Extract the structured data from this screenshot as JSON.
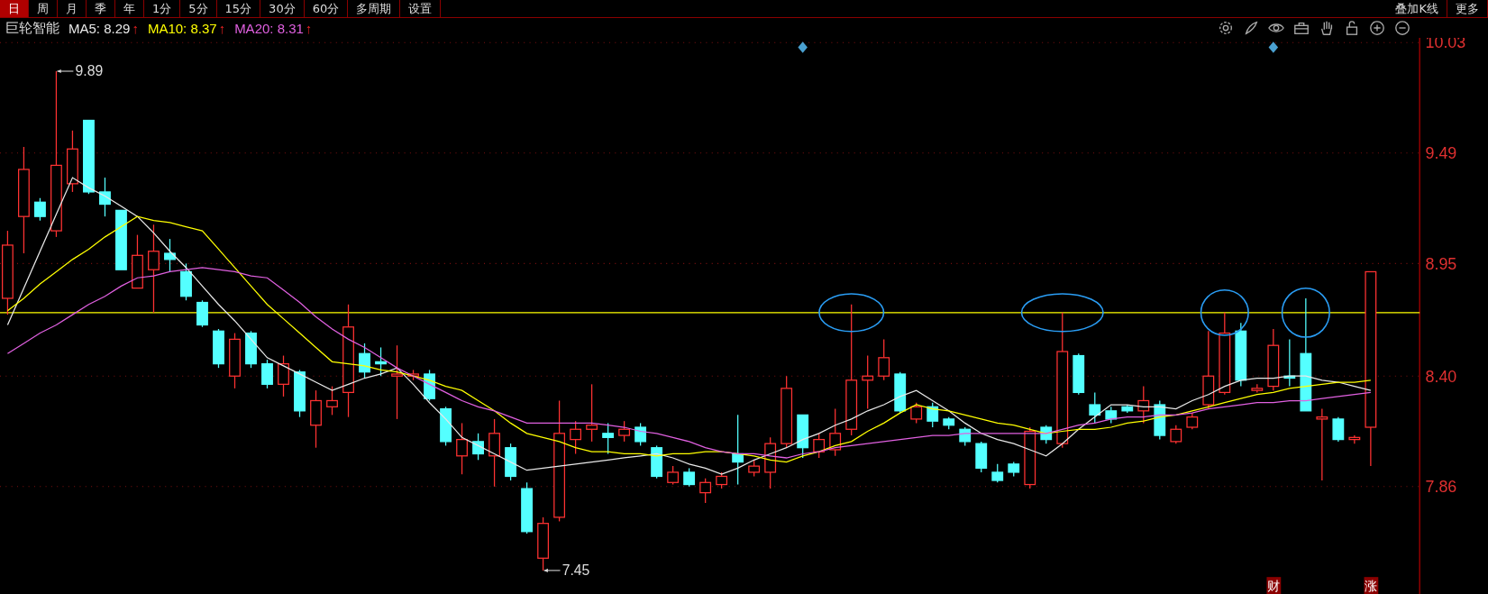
{
  "toolbar": {
    "left": [
      {
        "label": "日",
        "selected": true
      },
      {
        "label": "周",
        "selected": false
      },
      {
        "label": "月",
        "selected": false
      },
      {
        "label": "季",
        "selected": false
      },
      {
        "label": "年",
        "selected": false
      },
      {
        "label": "1分",
        "selected": false
      },
      {
        "label": "5分",
        "selected": false
      },
      {
        "label": "15分",
        "selected": false
      },
      {
        "label": "30分",
        "selected": false
      },
      {
        "label": "60分",
        "selected": false
      },
      {
        "label": "多周期",
        "selected": false
      },
      {
        "label": "设置",
        "selected": false
      }
    ],
    "right": [
      {
        "label": "叠加K线",
        "selected": false
      },
      {
        "label": "更多",
        "selected": false
      }
    ]
  },
  "header": {
    "name": "巨轮智能",
    "ma": [
      {
        "separator": ":",
        "value": "8.29",
        "trend": "↑"
      },
      {
        "separator": ":",
        "value": "8.37",
        "trend": "↑"
      },
      {
        "separator": ":",
        "value": "8.31",
        "trend": "↑"
      }
    ]
  },
  "chart_data": {
    "type": "candlestick",
    "ylim": [
      7.335,
      10.053
    ],
    "grid": true,
    "yticks": [
      {
        "value": 10.03,
        "label": "10.03"
      },
      {
        "value": 9.49,
        "label": "9.49"
      },
      {
        "value": 8.95,
        "label": "8.95"
      },
      {
        "value": 8.4,
        "label": "8.40"
      },
      {
        "value": 7.86,
        "label": "7.86"
      }
    ],
    "ohlc": [
      [
        8.78,
        9.11,
        8.7,
        9.04
      ],
      [
        9.18,
        9.52,
        9.0,
        9.41
      ],
      [
        9.25,
        9.27,
        9.16,
        9.18
      ],
      [
        9.11,
        9.89,
        9.08,
        9.43
      ],
      [
        9.34,
        9.6,
        9.3,
        9.51
      ],
      [
        9.65,
        9.65,
        9.29,
        9.3
      ],
      [
        9.3,
        9.37,
        9.18,
        9.24
      ],
      [
        9.21,
        9.21,
        8.92,
        8.92
      ],
      [
        8.83,
        9.09,
        8.83,
        8.99
      ],
      [
        8.92,
        9.14,
        8.71,
        9.01
      ],
      [
        9.0,
        9.07,
        8.91,
        8.97
      ],
      [
        8.91,
        8.95,
        8.77,
        8.79
      ],
      [
        8.76,
        8.77,
        8.64,
        8.65
      ],
      [
        8.62,
        8.63,
        8.44,
        8.46
      ],
      [
        8.4,
        8.61,
        8.34,
        8.58
      ],
      [
        8.61,
        8.62,
        8.44,
        8.46
      ],
      [
        8.46,
        8.48,
        8.34,
        8.36
      ],
      [
        8.36,
        8.5,
        8.3,
        8.46
      ],
      [
        8.42,
        8.43,
        8.2,
        8.23
      ],
      [
        8.16,
        8.33,
        8.05,
        8.28
      ],
      [
        8.25,
        8.35,
        8.21,
        8.28
      ],
      [
        8.32,
        8.75,
        8.2,
        8.64
      ],
      [
        8.51,
        8.56,
        8.39,
        8.42
      ],
      [
        8.47,
        8.54,
        8.4,
        8.46
      ],
      [
        8.4,
        8.55,
        8.19,
        8.41
      ],
      [
        8.4,
        8.43,
        8.38,
        8.41
      ],
      [
        8.41,
        8.43,
        8.28,
        8.29
      ],
      [
        8.24,
        8.25,
        8.06,
        8.08
      ],
      [
        8.01,
        8.17,
        7.92,
        8.09
      ],
      [
        8.08,
        8.12,
        7.99,
        8.02
      ],
      [
        8.01,
        8.19,
        7.86,
        8.12
      ],
      [
        8.05,
        8.07,
        7.89,
        7.91
      ],
      [
        7.85,
        7.88,
        7.63,
        7.64
      ],
      [
        7.51,
        7.71,
        7.45,
        7.68
      ],
      [
        7.71,
        8.28,
        7.69,
        8.12
      ],
      [
        8.09,
        8.18,
        8.02,
        8.14
      ],
      [
        8.14,
        8.36,
        8.08,
        8.16
      ],
      [
        8.12,
        8.17,
        8.02,
        8.1
      ],
      [
        8.11,
        8.18,
        8.08,
        8.14
      ],
      [
        8.15,
        8.17,
        8.06,
        8.08
      ],
      [
        8.05,
        8.06,
        7.9,
        7.91
      ],
      [
        7.88,
        7.96,
        7.87,
        7.93
      ],
      [
        7.93,
        7.95,
        7.86,
        7.87
      ],
      [
        7.83,
        7.9,
        7.78,
        7.88
      ],
      [
        7.87,
        7.93,
        7.85,
        7.91
      ],
      [
        8.02,
        8.21,
        7.87,
        7.98
      ],
      [
        7.93,
        7.99,
        7.91,
        7.96
      ],
      [
        7.93,
        8.1,
        7.85,
        8.07
      ],
      [
        8.07,
        8.4,
        8.05,
        8.34
      ],
      [
        8.21,
        8.21,
        8.0,
        8.05
      ],
      [
        8.03,
        8.12,
        8.0,
        8.09
      ],
      [
        8.04,
        8.24,
        8.01,
        8.12
      ],
      [
        8.14,
        8.75,
        8.11,
        8.38
      ],
      [
        8.38,
        8.5,
        8.24,
        8.4
      ],
      [
        8.4,
        8.58,
        8.38,
        8.49
      ],
      [
        8.41,
        8.42,
        8.22,
        8.23
      ],
      [
        8.19,
        8.27,
        8.17,
        8.25
      ],
      [
        8.25,
        8.27,
        8.15,
        8.18
      ],
      [
        8.19,
        8.2,
        8.14,
        8.16
      ],
      [
        8.14,
        8.15,
        8.06,
        8.08
      ],
      [
        8.07,
        8.08,
        7.93,
        7.95
      ],
      [
        7.93,
        7.97,
        7.88,
        7.89
      ],
      [
        7.97,
        7.98,
        7.91,
        7.93
      ],
      [
        7.87,
        8.15,
        7.85,
        8.13
      ],
      [
        8.15,
        8.16,
        8.07,
        8.09
      ],
      [
        8.07,
        8.71,
        8.05,
        8.52
      ],
      [
        8.5,
        8.51,
        8.31,
        8.32
      ],
      [
        8.26,
        8.32,
        8.17,
        8.21
      ],
      [
        8.23,
        8.25,
        8.17,
        8.19
      ],
      [
        8.25,
        8.26,
        8.22,
        8.23
      ],
      [
        8.23,
        8.35,
        8.17,
        8.28
      ],
      [
        8.26,
        8.28,
        8.09,
        8.11
      ],
      [
        8.08,
        8.16,
        8.07,
        8.14
      ],
      [
        8.15,
        8.22,
        8.14,
        8.2
      ],
      [
        8.26,
        8.62,
        8.24,
        8.4
      ],
      [
        8.32,
        8.71,
        8.31,
        8.61
      ],
      [
        8.62,
        8.66,
        8.35,
        8.38
      ],
      [
        8.33,
        8.36,
        8.32,
        8.34
      ],
      [
        8.35,
        8.63,
        8.33,
        8.55
      ],
      [
        8.4,
        8.58,
        8.35,
        8.39
      ],
      [
        8.51,
        8.78,
        8.23,
        8.23
      ],
      [
        8.19,
        8.24,
        7.89,
        8.2
      ],
      [
        8.19,
        8.2,
        8.08,
        8.09
      ],
      [
        8.09,
        8.11,
        8.07,
        8.1
      ],
      [
        8.15,
        8.91,
        7.96,
        8.91
      ]
    ],
    "series": [
      {
        "name": "MA5",
        "type": "line",
        "color": "#e8e8e8",
        "values": [
          8.65,
          8.83,
          9.01,
          9.19,
          9.37,
          9.32,
          9.28,
          9.23,
          9.18,
          9.1,
          9.01,
          8.93,
          8.84,
          8.75,
          8.67,
          8.58,
          8.49,
          8.45,
          8.41,
          8.37,
          8.33,
          8.36,
          8.39,
          8.41,
          8.44,
          8.36,
          8.27,
          8.19,
          8.1,
          8.06,
          8.02,
          7.98,
          7.94,
          7.95,
          7.96,
          7.97,
          7.98,
          7.99,
          8.0,
          8.01,
          8.02,
          8.0,
          7.97,
          7.95,
          7.92,
          7.95,
          7.99,
          8.02,
          8.05,
          8.09,
          8.12,
          8.16,
          8.19,
          8.23,
          8.26,
          8.3,
          8.33,
          8.28,
          8.23,
          8.17,
          8.12,
          8.09,
          8.07,
          8.04,
          8.01,
          8.07,
          8.14,
          8.2,
          8.26,
          8.26,
          8.25,
          8.25,
          8.24,
          8.28,
          8.31,
          8.35,
          8.38,
          8.39,
          8.39,
          8.4,
          8.4,
          8.38,
          8.37,
          8.35,
          8.33
        ]
      },
      {
        "name": "MA10",
        "type": "line",
        "color": "#ffff00",
        "values": [
          8.72,
          8.78,
          8.85,
          8.91,
          8.97,
          9.02,
          9.08,
          9.13,
          9.18,
          9.16,
          9.15,
          9.13,
          9.11,
          9.02,
          8.93,
          8.84,
          8.75,
          8.68,
          8.61,
          8.54,
          8.47,
          8.46,
          8.45,
          8.43,
          8.42,
          8.4,
          8.38,
          8.35,
          8.33,
          8.28,
          8.23,
          8.17,
          8.12,
          8.1,
          8.08,
          8.05,
          8.03,
          8.03,
          8.02,
          8.02,
          8.01,
          8.02,
          8.02,
          8.03,
          8.03,
          8.02,
          8.01,
          7.99,
          7.98,
          8.01,
          8.03,
          8.06,
          8.08,
          8.13,
          8.17,
          8.22,
          8.26,
          8.24,
          8.23,
          8.21,
          8.19,
          8.17,
          8.16,
          8.14,
          8.12,
          8.13,
          8.14,
          8.14,
          8.15,
          8.17,
          8.18,
          8.2,
          8.21,
          8.23,
          8.25,
          8.27,
          8.29,
          8.31,
          8.32,
          8.34,
          8.35,
          8.36,
          8.37,
          8.37,
          8.38
        ]
      },
      {
        "name": "MA20",
        "type": "line",
        "color": "#e060e0",
        "values": [
          8.51,
          8.56,
          8.61,
          8.65,
          8.7,
          8.75,
          8.79,
          8.84,
          8.88,
          8.89,
          8.91,
          8.92,
          8.93,
          8.92,
          8.91,
          8.89,
          8.88,
          8.82,
          8.76,
          8.69,
          8.63,
          8.58,
          8.54,
          8.49,
          8.44,
          8.4,
          8.36,
          8.32,
          8.28,
          8.25,
          8.23,
          8.2,
          8.17,
          8.17,
          8.17,
          8.17,
          8.17,
          8.16,
          8.15,
          8.13,
          8.12,
          8.1,
          8.08,
          8.05,
          8.03,
          8.02,
          8.02,
          8.01,
          8.0,
          8.02,
          8.03,
          8.05,
          8.06,
          8.07,
          8.08,
          8.09,
          8.1,
          8.11,
          8.11,
          8.12,
          8.12,
          8.12,
          8.12,
          8.12,
          8.12,
          8.14,
          8.16,
          8.17,
          8.19,
          8.2,
          8.2,
          8.21,
          8.21,
          8.22,
          8.24,
          8.25,
          8.26,
          8.27,
          8.27,
          8.28,
          8.28,
          8.29,
          8.3,
          8.31,
          8.32
        ]
      }
    ],
    "ref_lines": [
      {
        "axis": "y",
        "value": 8.71,
        "color": "#ffff00"
      }
    ],
    "annotations": [
      {
        "text": "9.89"
      },
      {
        "text": "7.45"
      },
      {
        "text": "财"
      },
      {
        "text": "涨"
      }
    ]
  }
}
